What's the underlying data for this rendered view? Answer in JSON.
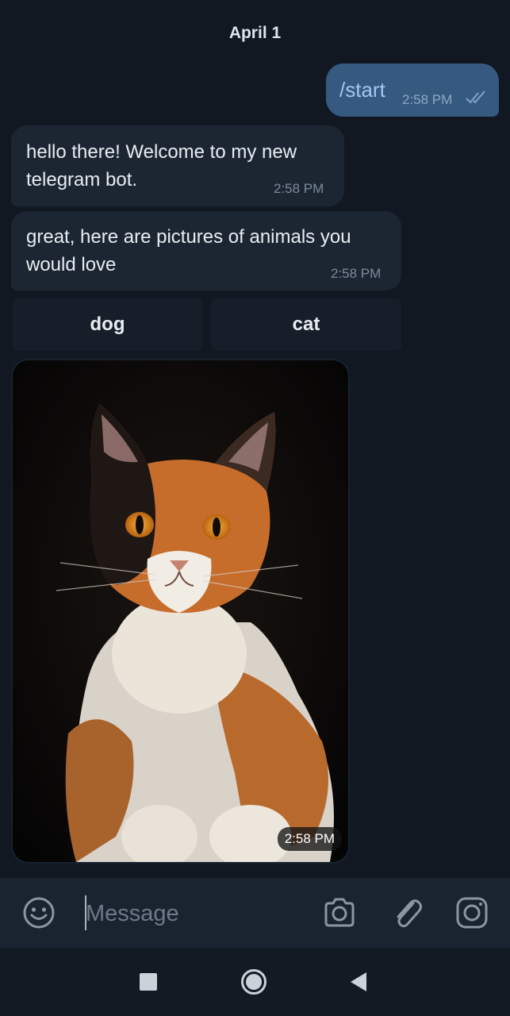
{
  "chat": {
    "date": "April 1",
    "outgoing": {
      "text": "/start",
      "time": "2:58 PM",
      "status_icon": "double-check-icon"
    },
    "incoming": [
      {
        "lines": [
          "hello there! Welcome to my new",
          "telegram bot."
        ],
        "time": "2:58 PM"
      },
      {
        "lines": [
          "great, here are pictures of animals you",
          "would love"
        ],
        "time": "2:58 PM"
      }
    ],
    "keyboard": [
      "dog",
      "cat"
    ],
    "photo": {
      "subject": "calico cat photo",
      "time": "2:58 PM"
    }
  },
  "input_bar": {
    "placeholder": "Message",
    "icons": [
      "emoji-icon",
      "camera-icon",
      "attach-icon",
      "instagram-icon"
    ]
  },
  "nav": {
    "icons": [
      "recents-square-icon",
      "home-circle-icon",
      "back-triangle-icon"
    ]
  },
  "colors": {
    "background": "#111822",
    "outgoing_bubble": "#36597f",
    "incoming_bubble": "#1c2633",
    "keyboard_button": "#151e29",
    "input_bar": "#1a2330",
    "accent_text": "#9fc6f2"
  }
}
